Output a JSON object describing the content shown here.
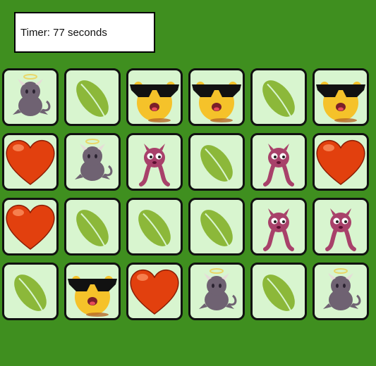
{
  "timer": {
    "label": "Timer:",
    "value": 77,
    "unit": "seconds",
    "text": "Timer: 77 seconds"
  },
  "board": {
    "rows": 4,
    "cols": 6,
    "cards": [
      [
        "devil",
        "leaf",
        "sunglasses-monster",
        "sunglasses-monster",
        "leaf",
        "sunglasses-monster"
      ],
      [
        "heart",
        "devil",
        "alien",
        "leaf",
        "alien",
        "heart"
      ],
      [
        "heart",
        "leaf",
        "leaf",
        "leaf",
        "alien",
        "alien"
      ],
      [
        "leaf",
        "sunglasses-monster",
        "heart",
        "devil",
        "leaf",
        "devil"
      ]
    ]
  },
  "colors": {
    "background": "#3f8f1f",
    "card_face": "#d8f5cf",
    "card_border": "#111111",
    "leaf": "#8cb83a",
    "heart": "#e2400e",
    "alien": "#a8416a",
    "devil": "#6f6272",
    "monster": "#f5c22a"
  }
}
